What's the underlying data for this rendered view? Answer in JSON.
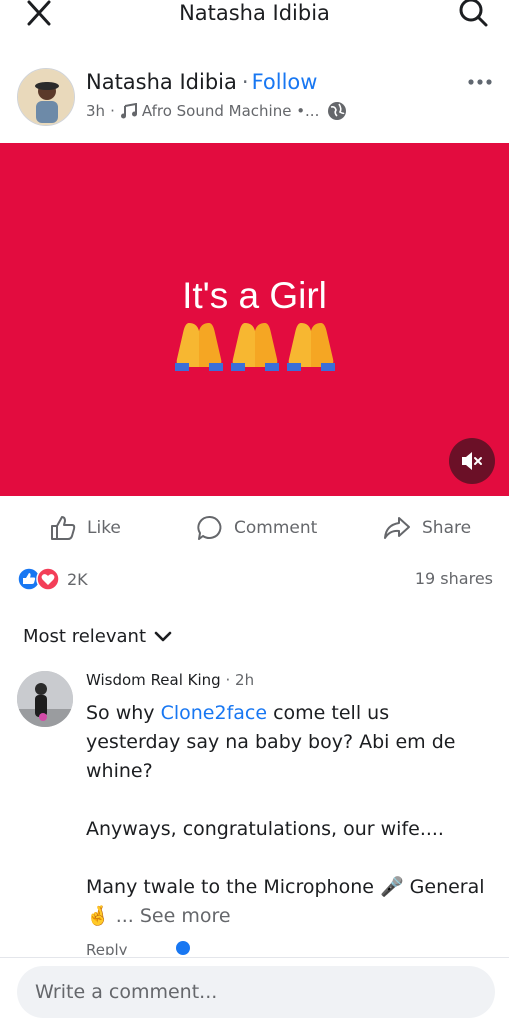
{
  "topbar": {
    "title": "Natasha Idibia",
    "close_icon": "close-icon",
    "search_icon": "search-icon"
  },
  "post": {
    "author": "Natasha Idibia",
    "separator": "·",
    "follow_label": "Follow",
    "time": "3h",
    "dot": "·",
    "audio": "Afro Sound Machine •...",
    "privacy_icon": "globe-icon",
    "more_icon": "more-horizontal-icon"
  },
  "media": {
    "background": "#e30c3f",
    "headline": "It's a Girl",
    "emoji": "🙏🙏🙏",
    "mute_icon": "volume-muted-icon"
  },
  "actions": {
    "like": "Like",
    "comment": "Comment",
    "share": "Share"
  },
  "stats": {
    "reaction_count": "2K",
    "shares": "19 shares"
  },
  "comments_section": {
    "sort_label": "Most relevant"
  },
  "comment": {
    "author": "Wisdom Real King",
    "time": "· 2h",
    "line1_pre": "So why ",
    "mention": "Clone2face",
    "line1_post": " come tell us yesterday say na baby boy? Abi em de whine?",
    "para2": "Anyways, congratulations, our wife....",
    "para3_pre": "Many twale to the Microphone 🎤 General 🤞",
    "ellipsis": " ... ",
    "see_more": "See more",
    "reply": "Reply"
  },
  "composer": {
    "placeholder": "Write a comment..."
  },
  "colors": {
    "accent": "#1877f2",
    "muted_text": "#65676b",
    "love": "#f33e58"
  }
}
